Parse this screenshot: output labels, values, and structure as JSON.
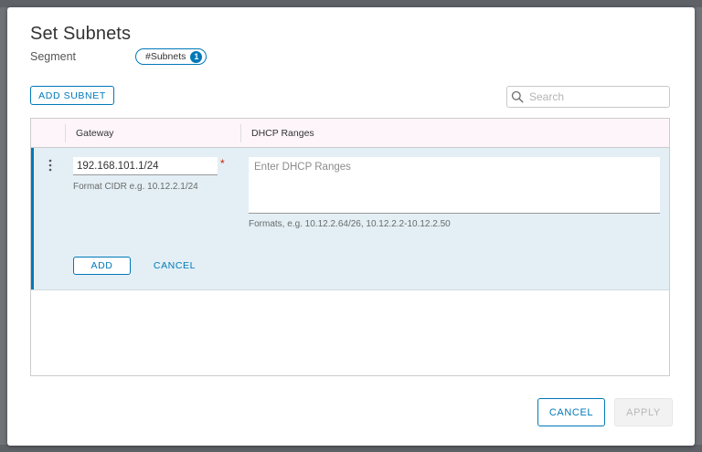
{
  "dialog": {
    "title": "Set Subnets",
    "segment_label": "Segment",
    "subnets_chip": {
      "label": "#Subnets",
      "count": "1"
    }
  },
  "toolbar": {
    "add_subnet_label": "ADD SUBNET",
    "search_placeholder": "Search",
    "search_icon": "search-icon"
  },
  "grid": {
    "columns": [
      "Gateway",
      "DHCP Ranges"
    ],
    "edit_row": {
      "gateway_value": "192.168.101.1/24",
      "gateway_required_marker": "*",
      "gateway_hint": "Format CIDR e.g. 10.12.2.1/24",
      "dhcp_placeholder": "Enter DHCP Ranges",
      "dhcp_hint": "Formats, e.g. 10.12.2.64/26, 10.12.2.2-10.12.2.50",
      "add_label": "ADD",
      "cancel_label": "CANCEL",
      "menu_icon": "vertical-ellipsis-icon"
    }
  },
  "footer": {
    "cancel_label": "CANCEL",
    "apply_label": "APPLY"
  },
  "colors": {
    "accent": "#0079b8",
    "row_highlight": "#e3eff5",
    "required": "#c92100",
    "header_bg": "#fdf5fa"
  }
}
